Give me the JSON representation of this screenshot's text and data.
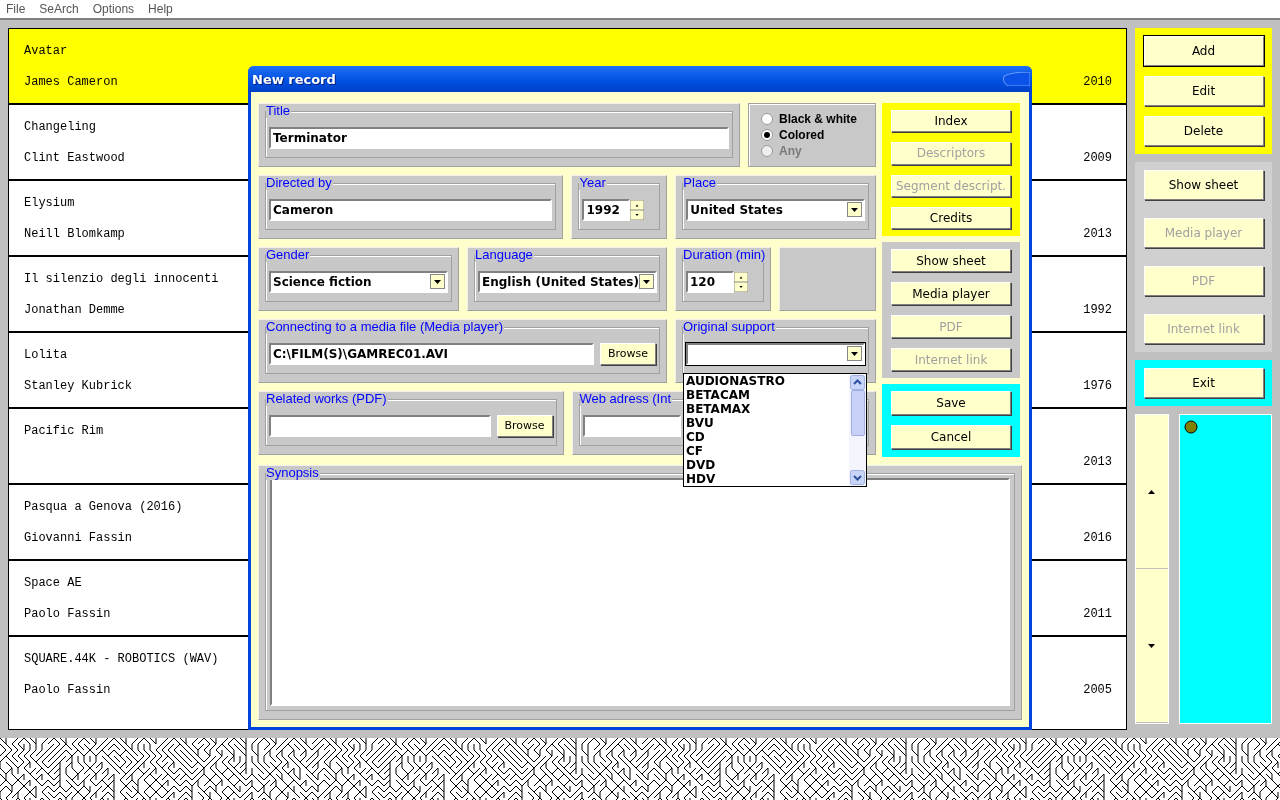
{
  "menu": [
    {
      "label": "File"
    },
    {
      "label": "SeArch"
    },
    {
      "label": "Options"
    },
    {
      "label": "Help"
    }
  ],
  "records": [
    {
      "title": "Avatar",
      "director": "James Cameron",
      "year": "2010",
      "selected": true
    },
    {
      "title": "Changeling",
      "director": "Clint Eastwood",
      "year": "2009",
      "selected": false
    },
    {
      "title": "Elysium",
      "director": "Neill Blomkamp",
      "year": "2013",
      "selected": false
    },
    {
      "title": "Il silenzio degli innocenti",
      "director": "Jonathan Demme",
      "year": "1992",
      "selected": false
    },
    {
      "title": "Lolita",
      "director": "Stanley Kubrick",
      "year": "1976",
      "selected": false
    },
    {
      "title": "Pacific Rim",
      "year": "2013",
      "selected": false
    },
    {
      "title": "Pasqua a Genova (2016)",
      "director": "Giovanni Fassin",
      "year": "2016",
      "selected": false
    },
    {
      "title": "Space AE",
      "director": "Paolo Fassin",
      "year": "2011",
      "selected": false
    },
    {
      "title": "SQUARE.44K - ROBOTICS (WAV)",
      "director": "Paolo Fassin",
      "year": "2005",
      "selected": false
    }
  ],
  "side_groups": [
    {
      "buttons": [
        {
          "label": "Add",
          "disabled": false,
          "focused": true
        },
        {
          "label": "Edit",
          "disabled": false,
          "focused": false
        },
        {
          "label": "Delete",
          "disabled": false,
          "focused": false
        }
      ]
    },
    {
      "buttons": [
        {
          "label": "Show sheet",
          "disabled": false,
          "focused": false
        },
        {
          "label": "Media player",
          "disabled": true,
          "focused": false
        },
        {
          "label": "PDF",
          "disabled": true,
          "focused": false
        },
        {
          "label": "Internet link",
          "disabled": true,
          "focused": false
        }
      ]
    },
    {
      "buttons": [
        {
          "label": "Exit",
          "disabled": false,
          "focused": false
        }
      ]
    }
  ],
  "dialog": {
    "title": "New record",
    "sections": [
      {
        "groups": [
          {
            "kind": "text",
            "label": "Title",
            "value": "Terminator"
          },
          {
            "kind": "radio",
            "options": [
              {
                "label": "Black & white",
                "selected": false,
                "disabled": false
              },
              {
                "label": "Colored",
                "selected": true,
                "disabled": false
              },
              {
                "label": "Any",
                "selected": false,
                "disabled": true
              }
            ]
          }
        ]
      },
      {
        "groups": [
          {
            "kind": "text",
            "label": "Directed by",
            "value": "Cameron"
          },
          {
            "kind": "spin",
            "label": "Year",
            "value": "1992"
          },
          {
            "kind": "combo",
            "label": "Place",
            "value": "United States"
          }
        ]
      },
      {
        "groups": [
          {
            "kind": "combo",
            "label": "Gender",
            "value": "Science fiction"
          },
          {
            "kind": "combo",
            "label": "Language",
            "value": "English (United States)"
          },
          {
            "kind": "spin",
            "label": "Duration (min)",
            "value": "120"
          },
          {
            "kind": "empty"
          }
        ]
      },
      {
        "groups": [
          {
            "kind": "browse",
            "label": "Connecting to a media file (Media player)",
            "value": "C:\\FILM(S)\\GAMREC01.AVI",
            "button": "Browse"
          },
          {
            "kind": "combo",
            "label": "Original support",
            "open": true,
            "options": [
              "AUDIONASTRO",
              "BETACAM",
              "BETAMAX",
              "BVU",
              "CD",
              "CF",
              "DVD",
              "HDV"
            ]
          }
        ]
      },
      {
        "groups": [
          {
            "kind": "browse",
            "label": "Related works (PDF)",
            "button": "Browse"
          },
          {
            "kind": "text",
            "label": "Web adress (Int"
          }
        ]
      }
    ],
    "synopsis": {
      "label": "Synopsis"
    },
    "button_groups": [
      {
        "buttons": [
          {
            "label": "Index",
            "disabled": false
          },
          {
            "label": "Descriptors",
            "disabled": true
          },
          {
            "label": "Segment descript.",
            "disabled": true
          },
          {
            "label": "Credits",
            "disabled": false
          }
        ]
      },
      {
        "buttons": [
          {
            "label": "Show sheet",
            "disabled": false
          },
          {
            "label": "Media player",
            "disabled": false
          },
          {
            "label": "PDF",
            "disabled": true
          },
          {
            "label": "Internet link",
            "disabled": true
          }
        ]
      },
      {
        "buttons": [
          {
            "label": "Save",
            "disabled": false
          },
          {
            "label": "Cancel",
            "disabled": false
          }
        ]
      }
    ]
  }
}
